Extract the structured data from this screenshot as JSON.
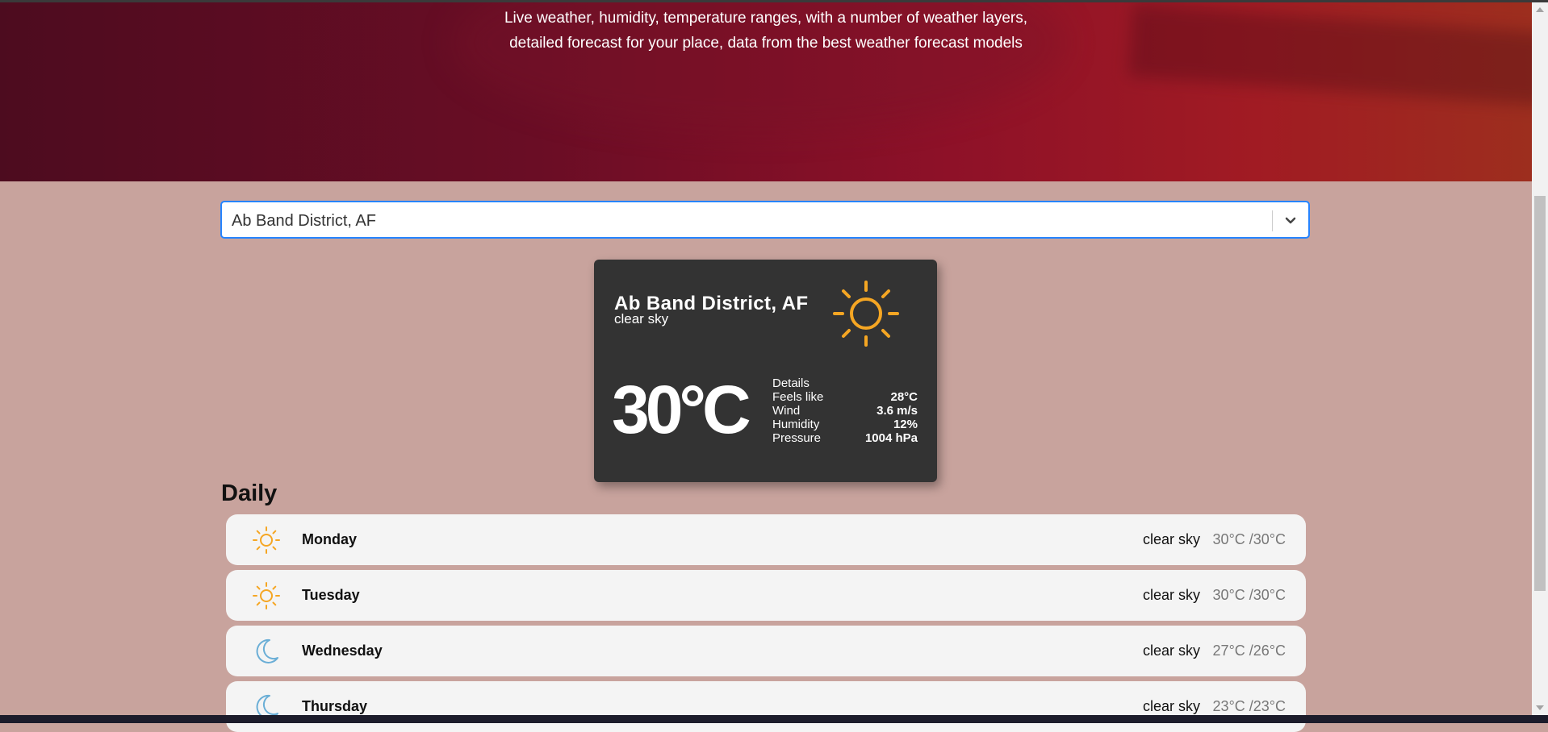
{
  "hero": {
    "line1": "Live weather, humidity, temperature ranges, with a number of weather layers,",
    "line2": "detailed forecast for your place, data from the best weather forecast models"
  },
  "search": {
    "value": "Ab Band District, AF",
    "chevron_icon": "chevron-down-icon"
  },
  "current": {
    "city": "Ab Band District, AF",
    "description": "clear sky",
    "icon": "sun-icon",
    "temperature": "30°C",
    "details_label": "Details",
    "details": [
      {
        "label": "Feels like",
        "value": "28°C"
      },
      {
        "label": "Wind",
        "value": "3.6 m/s"
      },
      {
        "label": "Humidity",
        "value": "12%"
      },
      {
        "label": "Pressure",
        "value": "1004 hPa"
      }
    ]
  },
  "daily": {
    "title": "Daily",
    "items": [
      {
        "day": "Monday",
        "description": "clear sky",
        "range": "30°C /30°C",
        "icon": "sun-icon"
      },
      {
        "day": "Tuesday",
        "description": "clear sky",
        "range": "30°C /30°C",
        "icon": "sun-icon"
      },
      {
        "day": "Wednesday",
        "description": "clear sky",
        "range": "27°C /26°C",
        "icon": "moon-icon"
      },
      {
        "day": "Thursday",
        "description": "clear sky",
        "range": "23°C /23°C",
        "icon": "moon-icon"
      }
    ]
  },
  "colors": {
    "page_bg": "#c8a39d",
    "card_bg": "#333333",
    "sun": "#f5a623",
    "moon": "#6aaed6",
    "focus_border": "#2684ff"
  }
}
